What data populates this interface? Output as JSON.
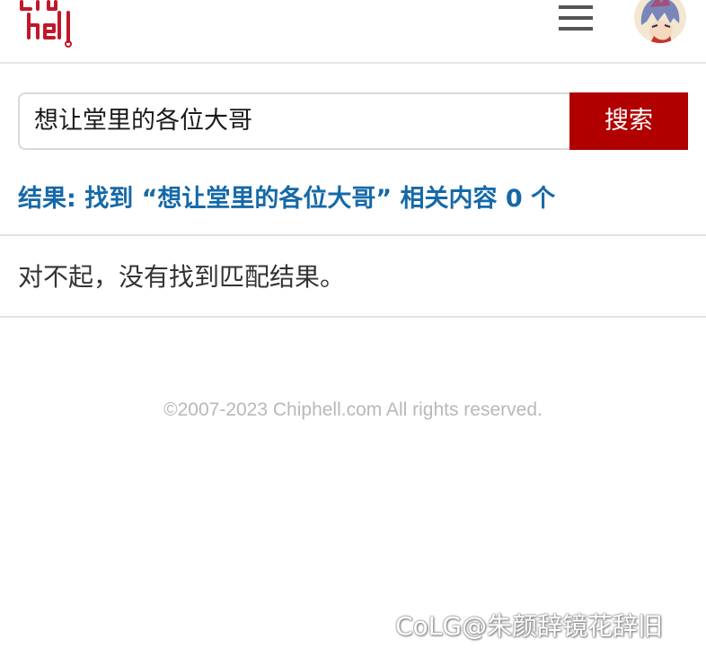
{
  "header": {
    "logo_text": "chiphell",
    "menu_icon": "hamburger-menu-icon",
    "avatar_icon": "user-avatar",
    "brand_color": "#b00000"
  },
  "search": {
    "query": "想让堂里的各位大哥",
    "button_label": "搜索"
  },
  "results": {
    "heading": "结果: 找到 “想让堂里的各位大哥” 相关内容 0 个",
    "empty_message": "对不起，没有找到匹配结果。",
    "heading_color": "#1569a8"
  },
  "footer": {
    "copyright": "©2007-2023 Chiphell.com All rights reserved."
  },
  "watermark": {
    "text": "CoLG@朱颜辞镜花辞旧"
  }
}
